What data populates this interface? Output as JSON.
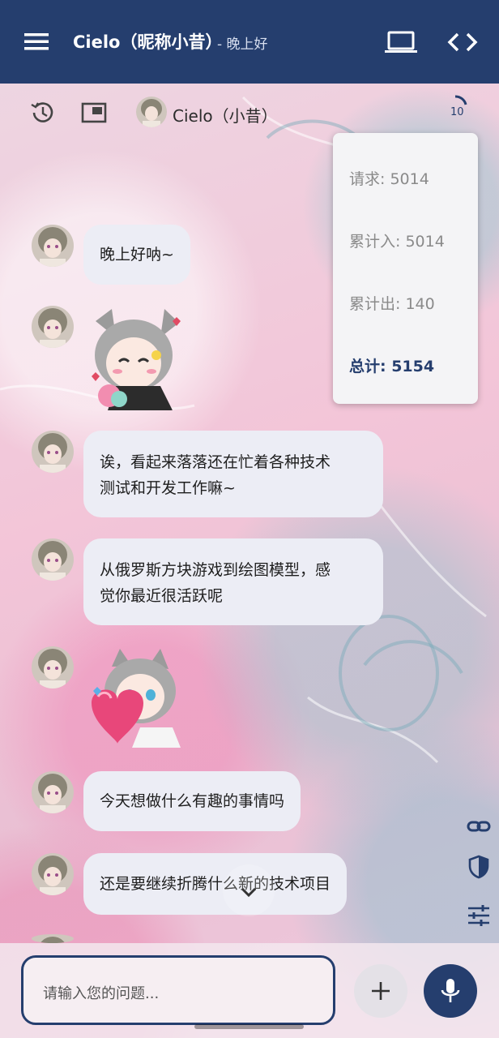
{
  "header": {
    "title": "Cielo（昵称小昔）",
    "subtitle": "- 晚上好"
  },
  "toolbar": {
    "character_name": "Cielo（小昔）",
    "counter_value": "10"
  },
  "stats": {
    "request": "请求: 5014",
    "cumulative_in": "累计入: 5014",
    "cumulative_out": "累计出: 140",
    "total": "总计: 5154"
  },
  "messages": [
    {
      "type": "text",
      "text": "晚上好呐~"
    },
    {
      "type": "sticker",
      "icon": "cat-girl-sticker"
    },
    {
      "type": "text",
      "line1": "诶，看起来落落还在忙着各种技术",
      "line2": "测试和开发工作嘛~"
    },
    {
      "type": "text",
      "line1": "从俄罗斯方块游戏到绘图模型，感",
      "line2": "觉你最近很活跃呢"
    },
    {
      "type": "sticker",
      "icon": "cat-girl-heart-sticker"
    },
    {
      "type": "text",
      "text": "今天想做什么有趣的事情吗"
    },
    {
      "type": "text",
      "text": "还是要继续折腾什么新的技术项目"
    }
  ],
  "input": {
    "placeholder": "请输入您的问题..."
  },
  "colors": {
    "primary": "#253e6e",
    "bubble": "#ecedf5"
  }
}
